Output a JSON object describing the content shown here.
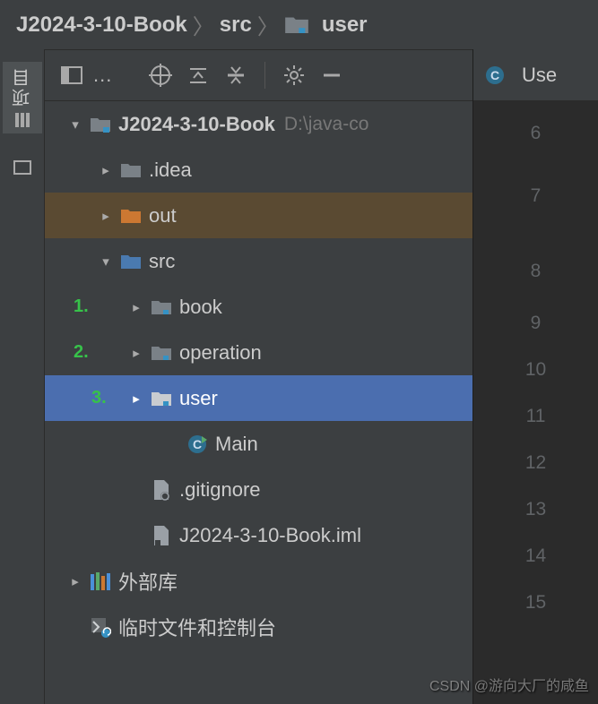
{
  "breadcrumb": {
    "root": "J2024-3-10-Book",
    "parts": [
      "src",
      "user"
    ]
  },
  "leftStrip": {
    "label": "项目"
  },
  "toolbar": {
    "dots": "..."
  },
  "gutter": {
    "tabLabel": "Use",
    "lineNumbers": [
      "6",
      "7",
      "8",
      "9",
      "10",
      "11",
      "12",
      "13",
      "14",
      "15"
    ]
  },
  "tree": {
    "root": {
      "name": "J2024-3-10-Book",
      "path": "D:\\java-co"
    },
    "idea": ".idea",
    "out": "out",
    "src": "src",
    "book": "book",
    "operation": "operation",
    "user": "user",
    "main": "Main",
    "gitignore": ".gitignore",
    "iml": "J2024-3-10-Book.iml",
    "extlib": "外部库",
    "scratch": "临时文件和控制台"
  },
  "annotations": {
    "n1": "1.",
    "n2": "2.",
    "n3": "3."
  },
  "watermark": "CSDN @游向大厂的咸鱼"
}
